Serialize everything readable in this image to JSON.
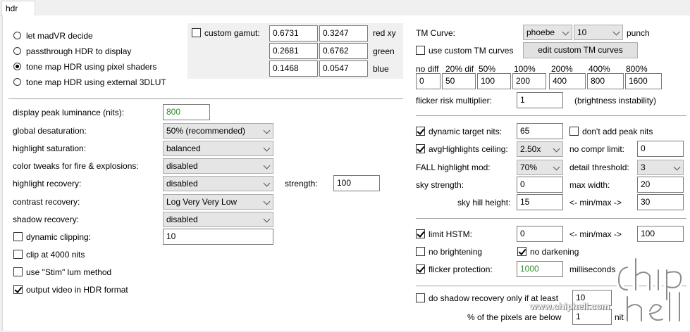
{
  "tab": {
    "label": "hdr"
  },
  "modes": [
    {
      "label": "let madVR decide",
      "selected": false
    },
    {
      "label": "passthrough HDR to display",
      "selected": false
    },
    {
      "label": "tone map HDR using pixel shaders",
      "selected": true
    },
    {
      "label": "tone map HDR using external 3DLUT",
      "selected": false
    }
  ],
  "gamut": {
    "label": "custom gamut:",
    "checked": false,
    "rows": [
      {
        "x": "0.6731",
        "y": "0.3247",
        "name": "red xy"
      },
      {
        "x": "0.2681",
        "y": "0.6762",
        "name": "green"
      },
      {
        "x": "0.1468",
        "y": "0.0547",
        "name": "blue"
      }
    ]
  },
  "left": {
    "peak_label": "display peak luminance (nits):",
    "peak_value": "800",
    "desat_label": "global desaturation:",
    "desat_value": "50% (recommended)",
    "hlsat_label": "highlight saturation:",
    "hlsat_value": "balanced",
    "fire_label": "color tweaks for fire & explosions:",
    "fire_value": "disabled",
    "hlrec_label": "highlight recovery:",
    "hlrec_value": "disabled",
    "strength_label": "strength:",
    "strength_value": "100",
    "contrast_label": "contrast recovery:",
    "contrast_value": "Log Very Very Low",
    "shadow_label": "shadow recovery:",
    "shadow_value": "disabled",
    "dynclip_label": "dynamic clipping:",
    "dynclip_checked": false,
    "dynclip_value": "10",
    "clip4000_label": "clip at 4000 nits",
    "clip4000_checked": false,
    "stim_label": "use \"Stim\" lum method",
    "stim_checked": false,
    "outhdr_label": "output video in HDR format",
    "outhdr_checked": true
  },
  "tm": {
    "curve_label": "TM Curve:",
    "curve_value": "phoebe",
    "punch_value": "10",
    "punch_label": "punch",
    "custom_label": "use custom TM curves",
    "custom_checked": false,
    "edit_button": "edit custom TM curves",
    "headers": [
      "no diff",
      "20% dif",
      "50%",
      "100%",
      "200%",
      "400%",
      "800%"
    ],
    "values": [
      "0",
      "50",
      "100",
      "200",
      "400",
      "800",
      "1600"
    ],
    "flicker_label": "flicker risk multiplier:",
    "flicker_value": "1",
    "flicker_note": "(brightness instability)"
  },
  "dyn": {
    "target_label": "dynamic target nits:",
    "target_checked": true,
    "target_value": "65",
    "nopeak_label": "don't add peak nits",
    "nopeak_checked": false,
    "avg_label": "avgHighlights ceiling:",
    "avg_checked": true,
    "avg_value": "2.50x",
    "nocompr_label": "no compr limit:",
    "nocompr_value": "0",
    "fall_label": "FALL highlight mod:",
    "fall_value": "70%",
    "detail_label": "detail threshold:",
    "detail_value": "3",
    "sky_label": "sky strength:",
    "sky_value": "0",
    "maxw_label": "max width:",
    "maxw_value": "20",
    "hill_label": "sky hill height:",
    "hill_value": "15",
    "minmax_label": "<- min/max ->",
    "hill_max": "30"
  },
  "hstm": {
    "limit_label": "limit HSTM:",
    "limit_checked": true,
    "limit_min": "0",
    "minmax_label": "<- min/max ->",
    "limit_max": "100",
    "nobright_label": "no brightening",
    "nobright_checked": false,
    "nodark_label": "no darkening",
    "nodark_checked": true,
    "flprot_label": "flicker protection:",
    "flprot_checked": true,
    "flprot_value": "1000",
    "ms_label": "milliseconds"
  },
  "shadow_only": {
    "label": "do shadow recovery only if at least",
    "checked": false,
    "pct_value": "10",
    "pixels_label": "% of the pixels are below",
    "nits_value": "1",
    "nits_label": "nits"
  },
  "watermark": {
    "url": "www.chiphell.com",
    "logo_text": "chip hell"
  }
}
